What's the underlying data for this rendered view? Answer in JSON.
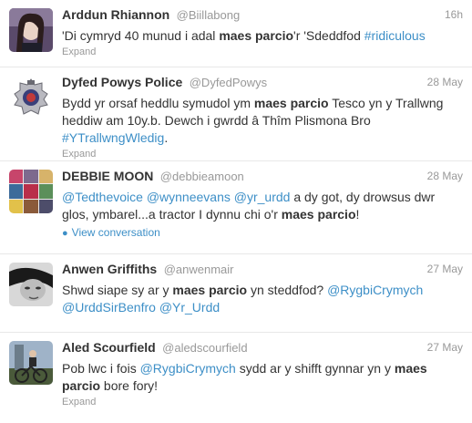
{
  "tweets": [
    {
      "fullname": "Arddun Rhiannon",
      "screen_name": "@Biillabong",
      "time": "16h",
      "text_segments": [
        {
          "t": "'Di cymryd 40 munud i adal ",
          "k": "plain"
        },
        {
          "t": "maes parcio",
          "k": "bold"
        },
        {
          "t": "'r 'Sdeddfod ",
          "k": "plain"
        },
        {
          "t": "#ridiculous",
          "k": "link"
        }
      ],
      "action": "Expand",
      "avatar_icon": "profile-photo-woman"
    },
    {
      "fullname": "Dyfed Powys Police",
      "screen_name": "@DyfedPowys",
      "time": "28 May",
      "text_segments": [
        {
          "t": "Bydd yr orsaf heddlu symudol ym ",
          "k": "plain"
        },
        {
          "t": "maes parcio",
          "k": "bold"
        },
        {
          "t": " Tesco yn y Trallwng heddiw am 10y.b. Dewch i gwrdd â Thîm Plismona Bro ",
          "k": "plain"
        },
        {
          "t": "#YTrallwngWledig",
          "k": "link"
        },
        {
          "t": ".",
          "k": "plain"
        }
      ],
      "action": "Expand",
      "avatar_icon": "police-badge"
    },
    {
      "fullname": "DEBBIE MOON",
      "screen_name": "@debbieamoon",
      "time": "28 May",
      "text_segments": [
        {
          "t": "@Tedthevoice",
          "k": "link"
        },
        {
          "t": " ",
          "k": "plain"
        },
        {
          "t": "@wynneevans",
          "k": "link"
        },
        {
          "t": " ",
          "k": "plain"
        },
        {
          "t": "@yr_urdd",
          "k": "link"
        },
        {
          "t": " a dy got, dy drowsus dwr glos, ymbarel...a tractor I dynnu chi o'r ",
          "k": "plain"
        },
        {
          "t": "maes parcio",
          "k": "bold"
        },
        {
          "t": "!",
          "k": "plain"
        }
      ],
      "action": "View conversation",
      "avatar_icon": "profile-photo-collage"
    },
    {
      "fullname": "Anwen Griffiths",
      "screen_name": "@anwenmair",
      "time": "27 May",
      "text_segments": [
        {
          "t": "Shwd siape sy ar y ",
          "k": "plain"
        },
        {
          "t": "maes parcio",
          "k": "bold"
        },
        {
          "t": " yn steddfod? ",
          "k": "plain"
        },
        {
          "t": "@RygbiCrymych",
          "k": "link"
        },
        {
          "t": " ",
          "k": "plain"
        },
        {
          "t": "@UrddSirBenfro",
          "k": "link"
        },
        {
          "t": " ",
          "k": "plain"
        },
        {
          "t": "@Yr_Urdd",
          "k": "link"
        }
      ],
      "action": "Expand",
      "avatar_icon": "profile-photo-bw"
    },
    {
      "fullname": "Aled Scourfield",
      "screen_name": "@aledscourfield",
      "time": "27 May",
      "text_segments": [
        {
          "t": "Pob lwc i fois ",
          "k": "plain"
        },
        {
          "t": "@RygbiCrymych",
          "k": "link"
        },
        {
          "t": " sydd ar y shifft gynnar yn y ",
          "k": "plain"
        },
        {
          "t": "maes parcio",
          "k": "bold"
        },
        {
          "t": " bore fory!",
          "k": "plain"
        }
      ],
      "action": "Expand",
      "avatar_icon": "profile-photo-bike"
    }
  ],
  "colors": {
    "link": "#3d8fc7",
    "muted": "#999999",
    "text": "#333333",
    "divider": "#e8e8e8"
  }
}
